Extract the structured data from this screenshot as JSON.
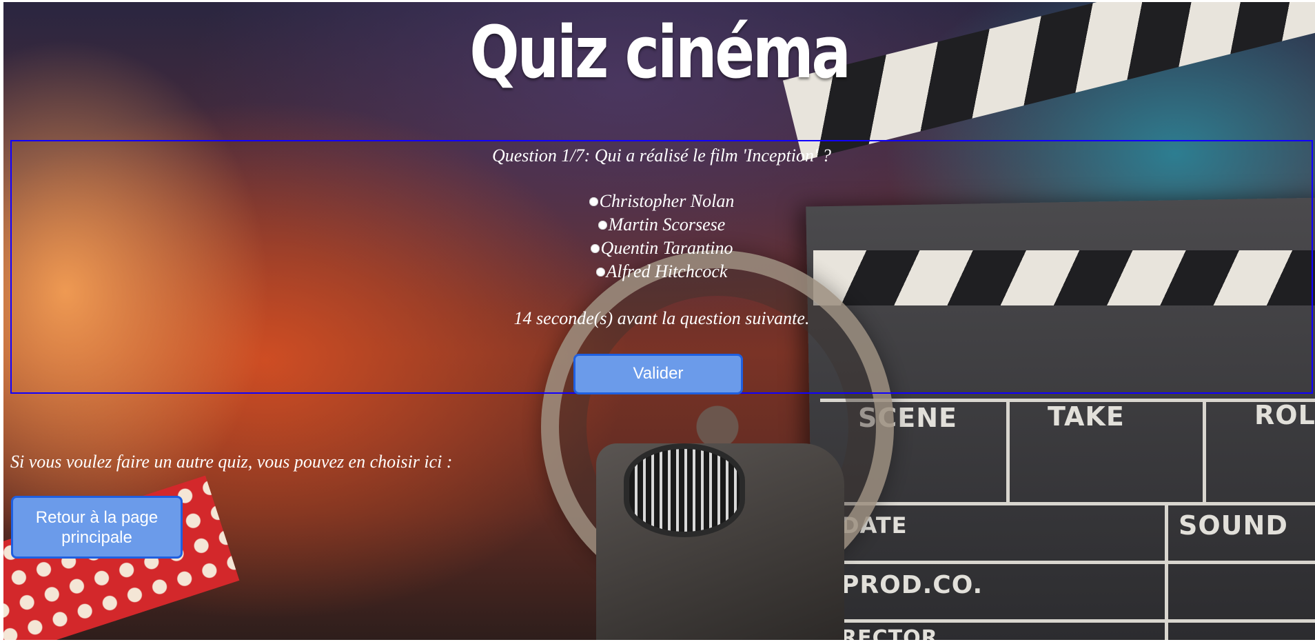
{
  "header": {
    "title": "Quiz cinéma"
  },
  "quiz": {
    "question": "Question 1/7: Qui a réalisé le film 'Inception' ?",
    "options": [
      "Christopher Nolan",
      "Martin Scorsese",
      "Quentin Tarantino",
      "Alfred Hitchcock"
    ],
    "timer_text": "14 seconde(s) avant la question suivante.",
    "validate_label": "Valider"
  },
  "footer": {
    "other_quiz_text": "Si vous voulez faire un autre quiz, vous pouvez en choisir ici :",
    "home_button_label": "Retour à la page principale"
  },
  "background": {
    "clapper_labels": [
      "SCENE",
      "TAKE",
      "ROL",
      "DATE",
      "SOUND",
      "PROD.CO.",
      "RECTOR"
    ]
  },
  "colors": {
    "button_fill": "#6b9bea",
    "button_border": "#1f5fe0",
    "quiz_box_border": "#1000ff",
    "text": "#ffffff"
  }
}
